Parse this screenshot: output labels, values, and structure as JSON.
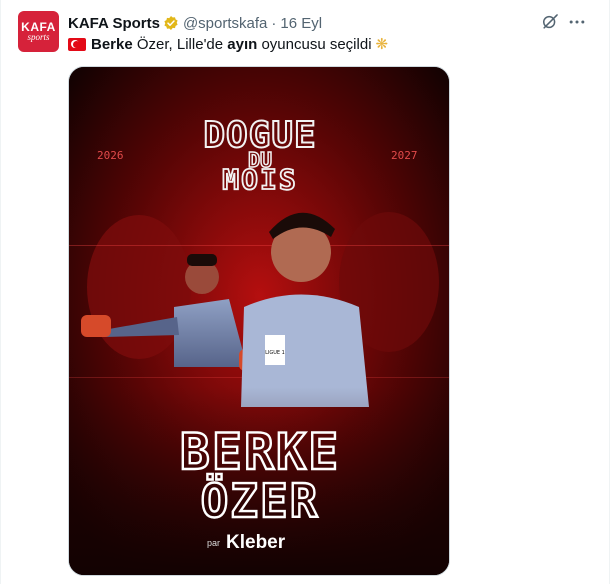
{
  "tweet": {
    "avatar": {
      "line1": "KAFA",
      "line2": "sports"
    },
    "display_name": "KAFA Sports",
    "handle": "@sportskafa",
    "separator": "·",
    "date": "16 Eyl",
    "text": {
      "name_bold": "Berke",
      "part1": " Özer, Lille'de ",
      "bold2": "ayın",
      "part2": " oyuncusu seçildi"
    },
    "icons": {
      "verified": "verified-badge-icon",
      "grok": "grok-icon",
      "more": "more-icon",
      "flag": "turkey-flag-icon",
      "clap": "clapping-hands-icon"
    },
    "colors": {
      "verified_gold": "#e2b719",
      "accent_red": "#d6223a",
      "text_secondary": "#536471"
    }
  },
  "poster": {
    "title_line1": "DOGUE",
    "title_line2": "DU",
    "title_line3": "MOIS",
    "year_left": "2026",
    "year_right": "2027",
    "player_first": "BERKE",
    "player_last": "ÖZER",
    "sponsor_prefix": "par",
    "sponsor": "Kleber",
    "badge": "LIGUE 1"
  }
}
